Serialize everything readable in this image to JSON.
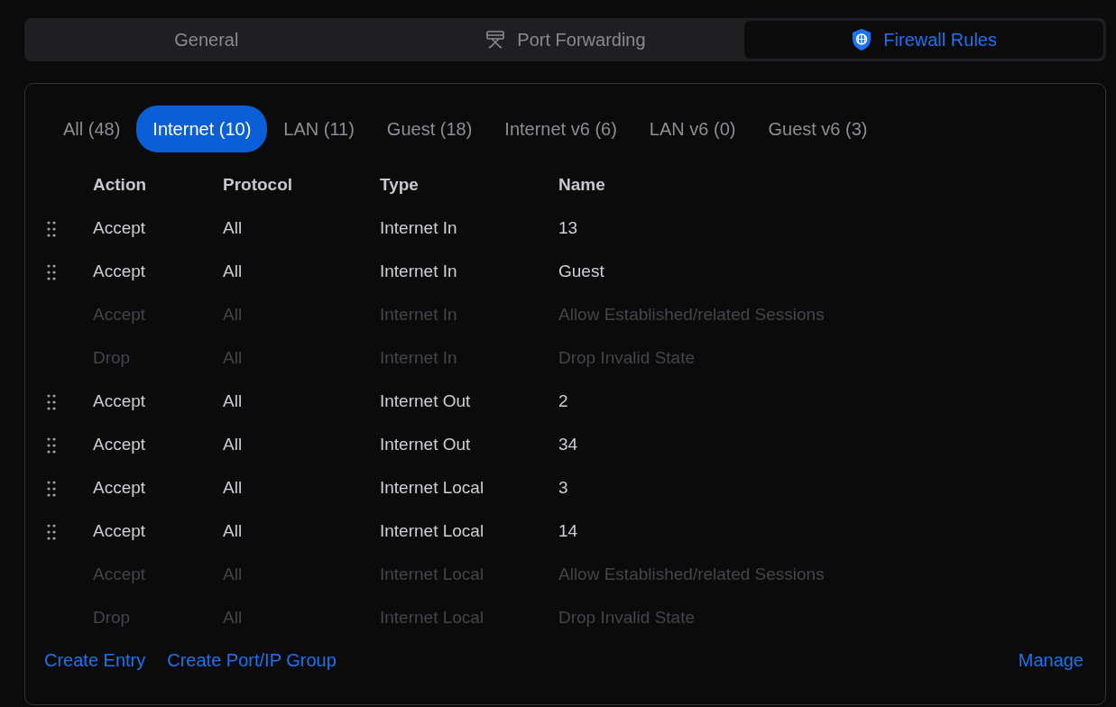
{
  "main_tabs": [
    {
      "label": "General",
      "kind": "plain",
      "selected": false
    },
    {
      "label": "Port Forwarding",
      "kind": "port",
      "selected": false
    },
    {
      "label": "Firewall Rules",
      "kind": "shield",
      "selected": true
    }
  ],
  "filters": [
    {
      "label": "All (48)",
      "selected": false
    },
    {
      "label": "Internet (10)",
      "selected": true
    },
    {
      "label": "LAN (11)",
      "selected": false
    },
    {
      "label": "Guest (18)",
      "selected": false
    },
    {
      "label": "Internet v6 (6)",
      "selected": false
    },
    {
      "label": "LAN v6 (0)",
      "selected": false
    },
    {
      "label": "Guest v6 (3)",
      "selected": false
    }
  ],
  "table": {
    "columns": [
      "Action",
      "Protocol",
      "Type",
      "Name"
    ],
    "rows": [
      {
        "editable": true,
        "cells": [
          "Accept",
          "All",
          "Internet In",
          "13"
        ]
      },
      {
        "editable": true,
        "cells": [
          "Accept",
          "All",
          "Internet In",
          "Guest"
        ]
      },
      {
        "editable": false,
        "cells": [
          "Accept",
          "All",
          "Internet In",
          "Allow Established/related Sessions"
        ]
      },
      {
        "editable": false,
        "cells": [
          "Drop",
          "All",
          "Internet In",
          "Drop Invalid State"
        ]
      },
      {
        "editable": true,
        "cells": [
          "Accept",
          "All",
          "Internet Out",
          "2"
        ]
      },
      {
        "editable": true,
        "cells": [
          "Accept",
          "All",
          "Internet Out",
          "34"
        ]
      },
      {
        "editable": true,
        "cells": [
          "Accept",
          "All",
          "Internet Local",
          "3"
        ]
      },
      {
        "editable": true,
        "cells": [
          "Accept",
          "All",
          "Internet Local",
          "14"
        ]
      },
      {
        "editable": false,
        "cells": [
          "Accept",
          "All",
          "Internet Local",
          "Allow Established/related Sessions"
        ]
      },
      {
        "editable": false,
        "cells": [
          "Drop",
          "All",
          "Internet Local",
          "Drop Invalid State"
        ]
      }
    ]
  },
  "footer_links": [
    "Create Entry",
    "Create Port/IP Group"
  ],
  "manage_link": "Manage"
}
